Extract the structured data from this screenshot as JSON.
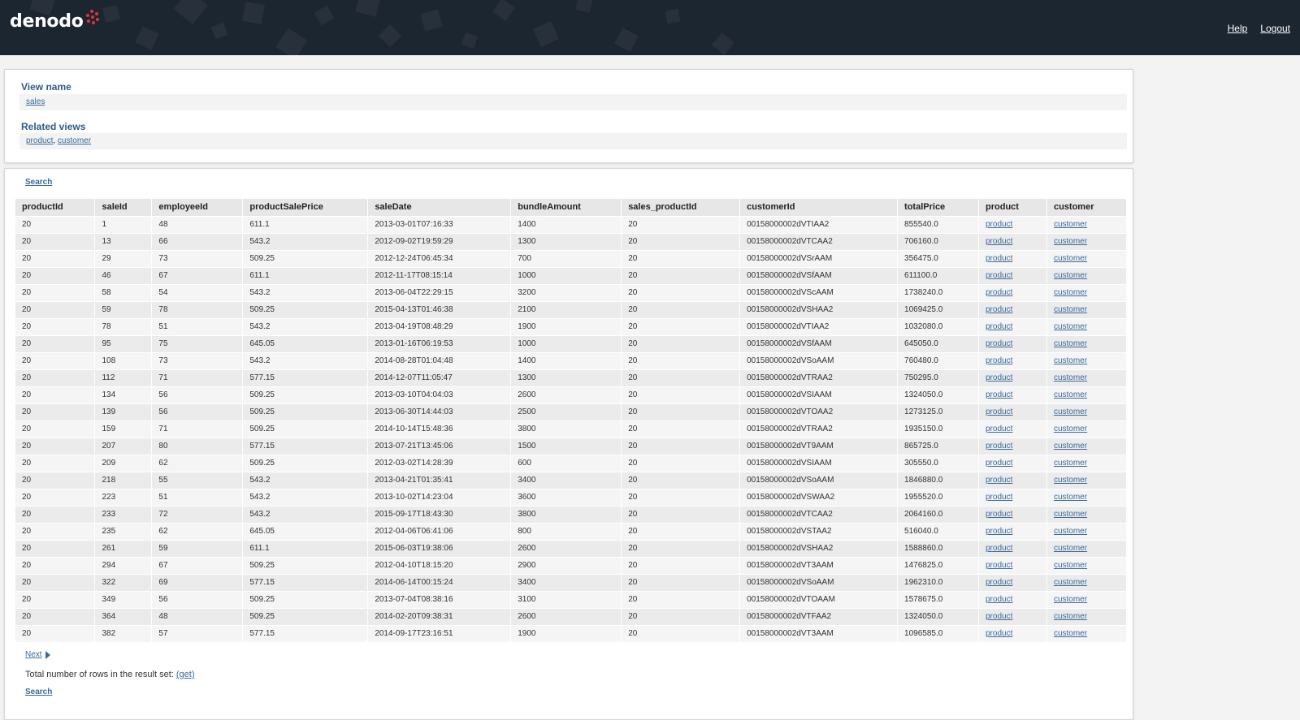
{
  "header": {
    "logo_text": "denodo",
    "links": [
      {
        "label": "Help"
      },
      {
        "label": "Logout"
      }
    ]
  },
  "info": {
    "view_name_title": "View name",
    "view_name_link": "sales",
    "related_views_title": "Related views",
    "related_views": [
      {
        "label": "product"
      },
      {
        "label": "customer"
      }
    ],
    "related_separator": ", "
  },
  "results": {
    "search_label": "Search",
    "columns": [
      "productId",
      "saleId",
      "employeeId",
      "productSalePrice",
      "saleDate",
      "bundleAmount",
      "sales_productId",
      "customerId",
      "totalPrice",
      "product",
      "customer"
    ],
    "rows": [
      [
        "20",
        "1",
        "48",
        "611.1",
        "2013-03-01T07:16:33",
        "1400",
        "20",
        "00158000002dVTIAA2",
        "855540.0",
        "product",
        "customer"
      ],
      [
        "20",
        "13",
        "66",
        "543.2",
        "2012-09-02T19:59:29",
        "1300",
        "20",
        "00158000002dVTCAA2",
        "706160.0",
        "product",
        "customer"
      ],
      [
        "20",
        "29",
        "73",
        "509.25",
        "2012-12-24T06:45:34",
        "700",
        "20",
        "00158000002dVSrAAM",
        "356475.0",
        "product",
        "customer"
      ],
      [
        "20",
        "46",
        "67",
        "611.1",
        "2012-11-17T08:15:14",
        "1000",
        "20",
        "00158000002dVSfAAM",
        "611100.0",
        "product",
        "customer"
      ],
      [
        "20",
        "58",
        "54",
        "543.2",
        "2013-06-04T22:29:15",
        "3200",
        "20",
        "00158000002dVScAAM",
        "1738240.0",
        "product",
        "customer"
      ],
      [
        "20",
        "59",
        "78",
        "509.25",
        "2015-04-13T01:46:38",
        "2100",
        "20",
        "00158000002dVSHAA2",
        "1069425.0",
        "product",
        "customer"
      ],
      [
        "20",
        "78",
        "51",
        "543.2",
        "2013-04-19T08:48:29",
        "1900",
        "20",
        "00158000002dVTIAA2",
        "1032080.0",
        "product",
        "customer"
      ],
      [
        "20",
        "95",
        "75",
        "645.05",
        "2013-01-16T06:19:53",
        "1000",
        "20",
        "00158000002dVSfAAM",
        "645050.0",
        "product",
        "customer"
      ],
      [
        "20",
        "108",
        "73",
        "543.2",
        "2014-08-28T01:04:48",
        "1400",
        "20",
        "00158000002dVSoAAM",
        "760480.0",
        "product",
        "customer"
      ],
      [
        "20",
        "112",
        "71",
        "577.15",
        "2014-12-07T11:05:47",
        "1300",
        "20",
        "00158000002dVTRAA2",
        "750295.0",
        "product",
        "customer"
      ],
      [
        "20",
        "134",
        "56",
        "509.25",
        "2013-03-10T04:04:03",
        "2600",
        "20",
        "00158000002dVSIAAM",
        "1324050.0",
        "product",
        "customer"
      ],
      [
        "20",
        "139",
        "56",
        "509.25",
        "2013-06-30T14:44:03",
        "2500",
        "20",
        "00158000002dVTOAA2",
        "1273125.0",
        "product",
        "customer"
      ],
      [
        "20",
        "159",
        "71",
        "509.25",
        "2014-10-14T15:48:36",
        "3800",
        "20",
        "00158000002dVTRAA2",
        "1935150.0",
        "product",
        "customer"
      ],
      [
        "20",
        "207",
        "80",
        "577.15",
        "2013-07-21T13:45:06",
        "1500",
        "20",
        "00158000002dVT9AAM",
        "865725.0",
        "product",
        "customer"
      ],
      [
        "20",
        "209",
        "62",
        "509.25",
        "2012-03-02T14:28:39",
        "600",
        "20",
        "00158000002dVSIAAM",
        "305550.0",
        "product",
        "customer"
      ],
      [
        "20",
        "218",
        "55",
        "543.2",
        "2013-04-21T01:35:41",
        "3400",
        "20",
        "00158000002dVSoAAM",
        "1846880.0",
        "product",
        "customer"
      ],
      [
        "20",
        "223",
        "51",
        "543.2",
        "2013-10-02T14:23:04",
        "3600",
        "20",
        "00158000002dVSWAA2",
        "1955520.0",
        "product",
        "customer"
      ],
      [
        "20",
        "233",
        "72",
        "543.2",
        "2015-09-17T18:43:30",
        "3800",
        "20",
        "00158000002dVTCAA2",
        "2064160.0",
        "product",
        "customer"
      ],
      [
        "20",
        "235",
        "62",
        "645.05",
        "2012-04-06T06:41:06",
        "800",
        "20",
        "00158000002dVSTAA2",
        "516040.0",
        "product",
        "customer"
      ],
      [
        "20",
        "261",
        "59",
        "611.1",
        "2015-06-03T19:38:06",
        "2600",
        "20",
        "00158000002dVSHAA2",
        "1588860.0",
        "product",
        "customer"
      ],
      [
        "20",
        "294",
        "67",
        "509.25",
        "2012-04-10T18:15:20",
        "2900",
        "20",
        "00158000002dVT3AAM",
        "1476825.0",
        "product",
        "customer"
      ],
      [
        "20",
        "322",
        "69",
        "577.15",
        "2014-06-14T00:15:24",
        "3400",
        "20",
        "00158000002dVSoAAM",
        "1962310.0",
        "product",
        "customer"
      ],
      [
        "20",
        "349",
        "56",
        "509.25",
        "2013-07-04T08:38:16",
        "3100",
        "20",
        "00158000002dVTOAAM",
        "1578675.0",
        "product",
        "customer"
      ],
      [
        "20",
        "364",
        "48",
        "509.25",
        "2014-02-20T09:38:31",
        "2600",
        "20",
        "00158000002dVTFAA2",
        "1324050.0",
        "product",
        "customer"
      ],
      [
        "20",
        "382",
        "57",
        "577.15",
        "2014-09-17T23:16:51",
        "1900",
        "20",
        "00158000002dVT3AAM",
        "1096585.0",
        "product",
        "customer"
      ]
    ],
    "link_columns": [
      9,
      10
    ],
    "next_label": "Next",
    "total_text": "Total number of rows in the result set:",
    "total_link": "(get)",
    "search_bottom_label": "Search"
  },
  "colors": {
    "header_bg": "#1c2630",
    "link": "#3a6a9a",
    "section_title": "#2f5a8b",
    "logo_accent": "#e0343b"
  }
}
